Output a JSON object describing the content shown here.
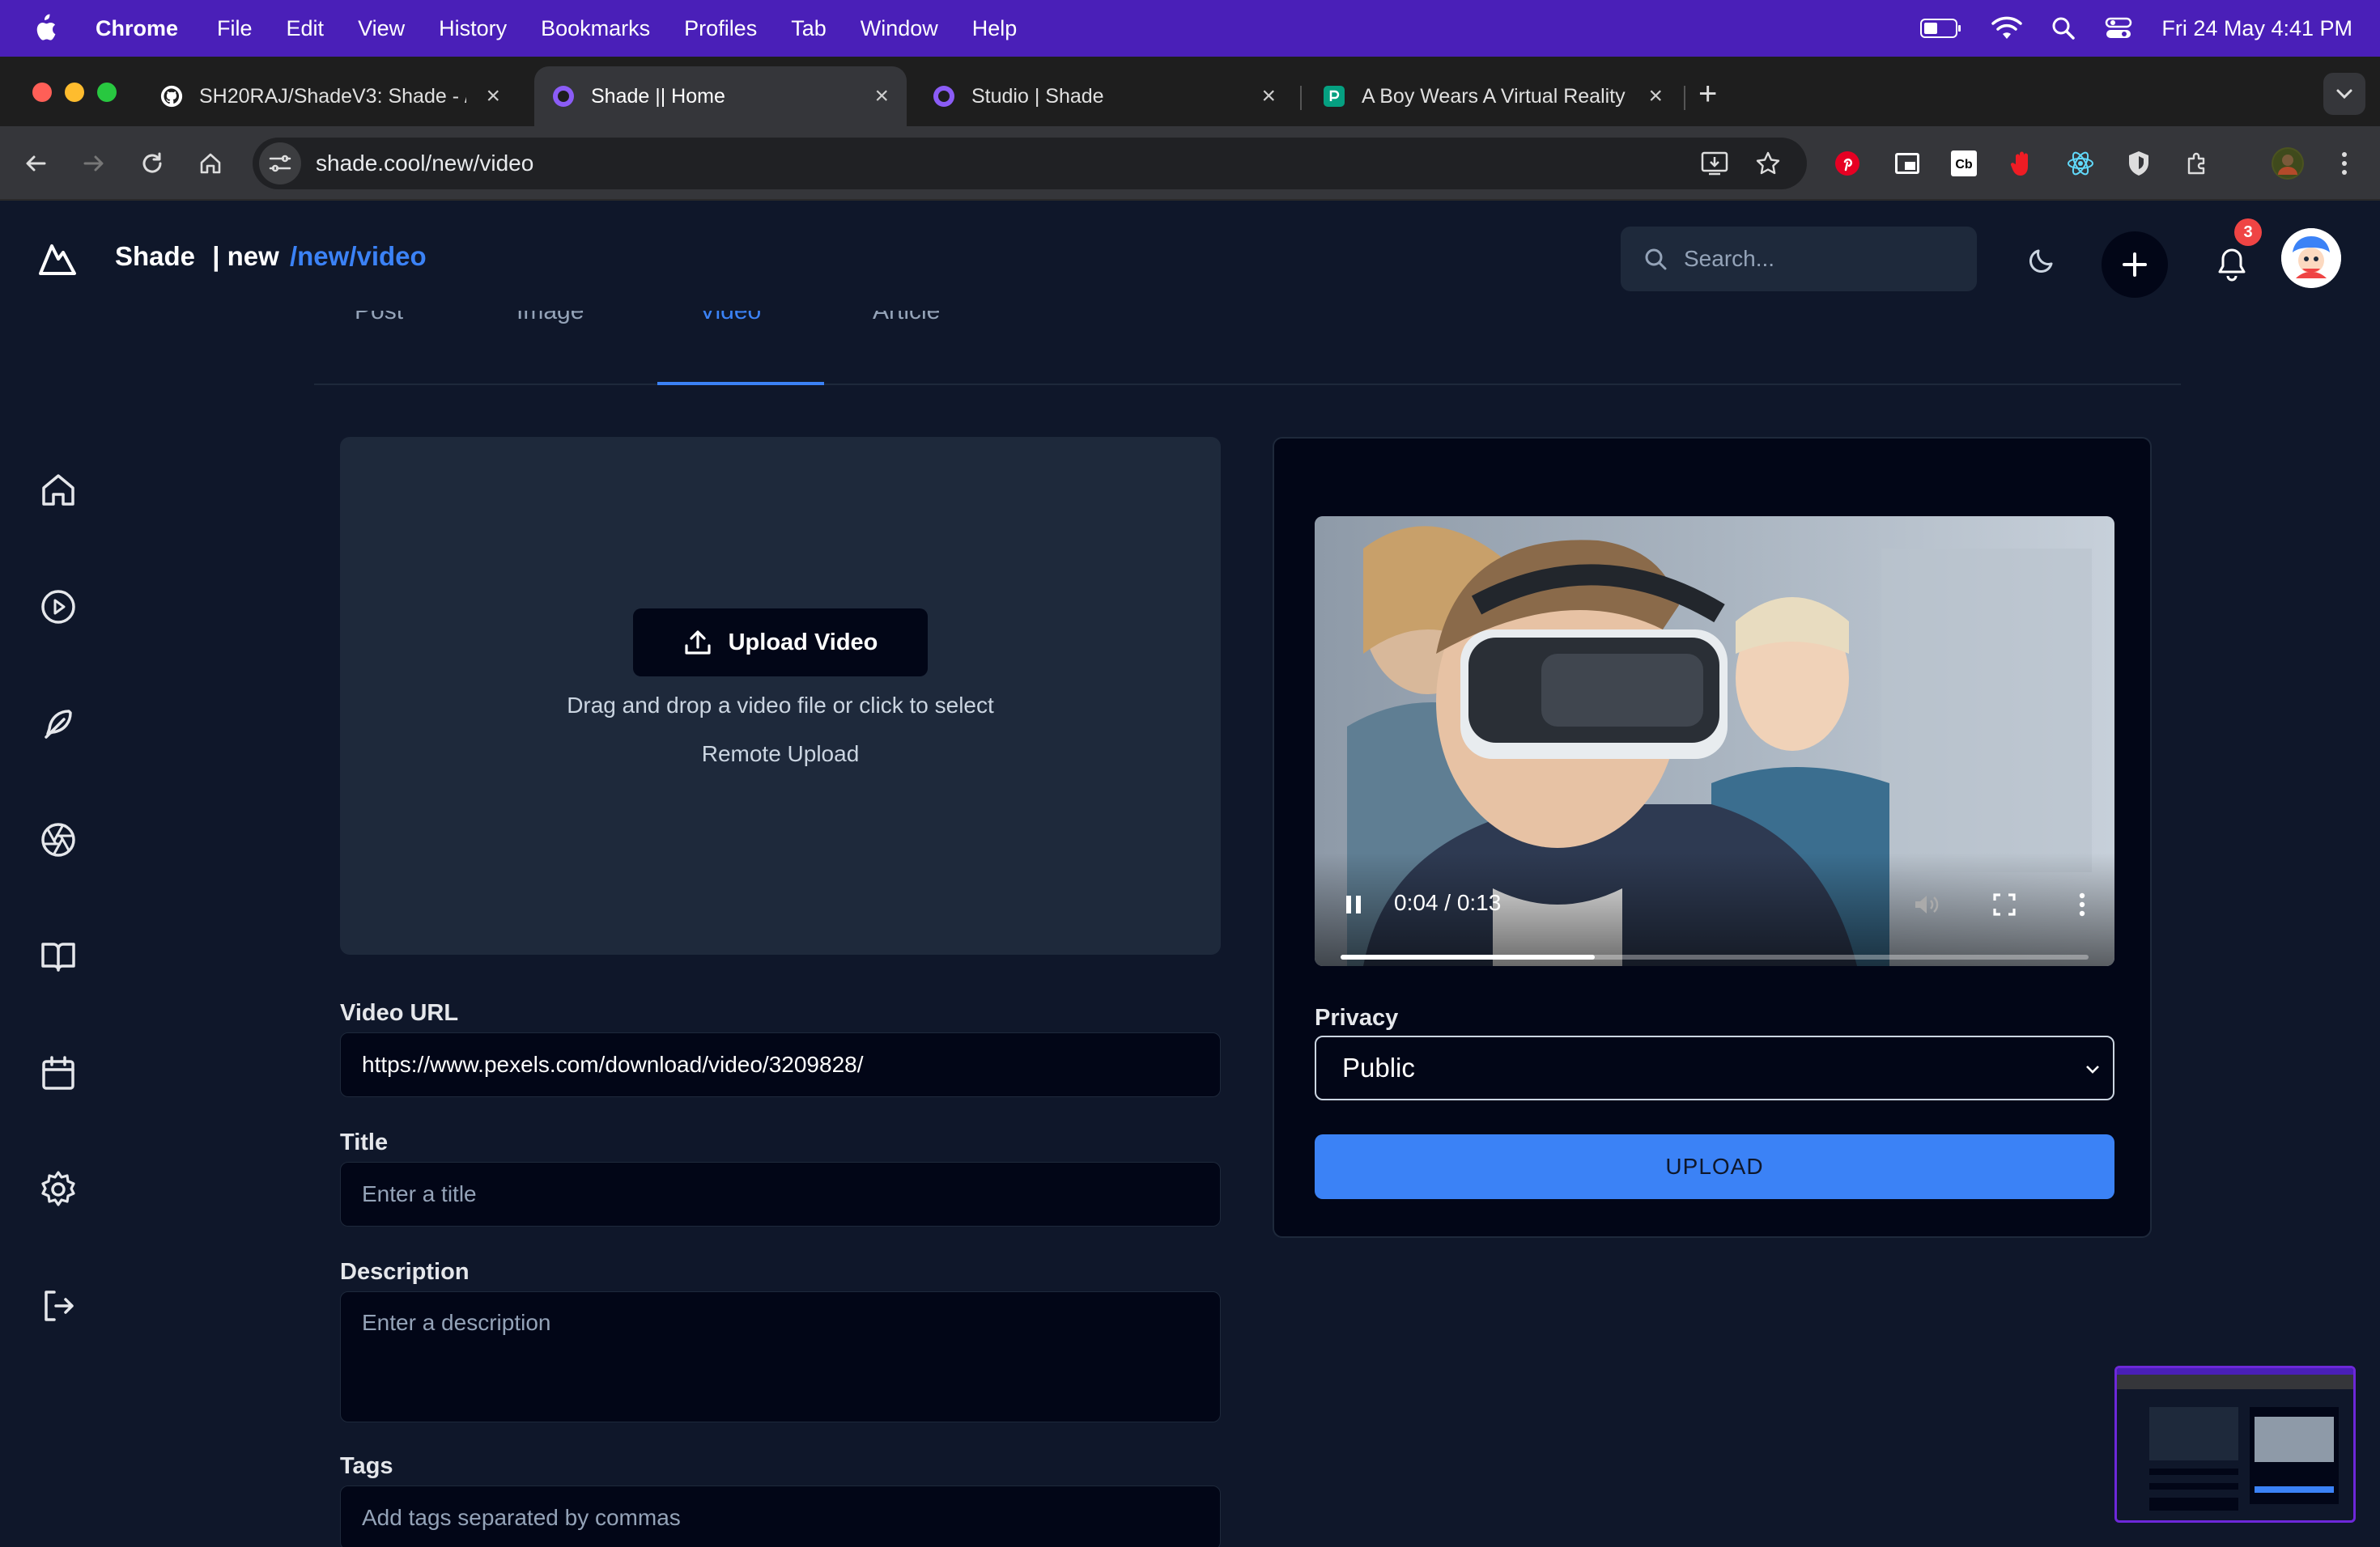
{
  "menubar": {
    "app": "Chrome",
    "items": [
      "File",
      "Edit",
      "View",
      "History",
      "Bookmarks",
      "Profiles",
      "Tab",
      "Window",
      "Help"
    ],
    "clock": "Fri 24 May  4:41 PM"
  },
  "browser": {
    "tabs": [
      {
        "title": "SH20RAJ/ShadeV3: Shade - /",
        "icon": "github-icon"
      },
      {
        "title": "Shade || Home",
        "icon": "shade-favicon"
      },
      {
        "title": "Studio | Shade",
        "icon": "shade-favicon"
      },
      {
        "title": "A Boy Wears A Virtual Reality",
        "icon": "pexels-favicon"
      }
    ],
    "url": "shade.cool/new/video"
  },
  "app": {
    "brand": "Shade",
    "breadcrumb_prefix": "| new",
    "breadcrumb_path": "/new/video",
    "search_placeholder": "Search...",
    "notification_count": "3"
  },
  "type_tabs": [
    "Post",
    "Image",
    "Video",
    "Article"
  ],
  "upload": {
    "button": "Upload Video",
    "hint": "Drag and drop a video file or click to select",
    "remote": "Remote Upload"
  },
  "form": {
    "video_url_label": "Video URL",
    "video_url_value": "https://www.pexels.com/download/video/3209828/",
    "title_label": "Title",
    "title_placeholder": "Enter a title",
    "description_label": "Description",
    "description_placeholder": "Enter a description",
    "tags_label": "Tags",
    "tags_placeholder": "Add tags separated by commas"
  },
  "player": {
    "time": "0:04 / 0:13",
    "progress": 0.34
  },
  "privacy": {
    "label": "Privacy",
    "selected": "Public"
  },
  "submit_label": "UPLOAD",
  "colors": {
    "accent": "#3b82f6",
    "menubar": "#4a1fb8",
    "page_bg": "#0f172a"
  }
}
